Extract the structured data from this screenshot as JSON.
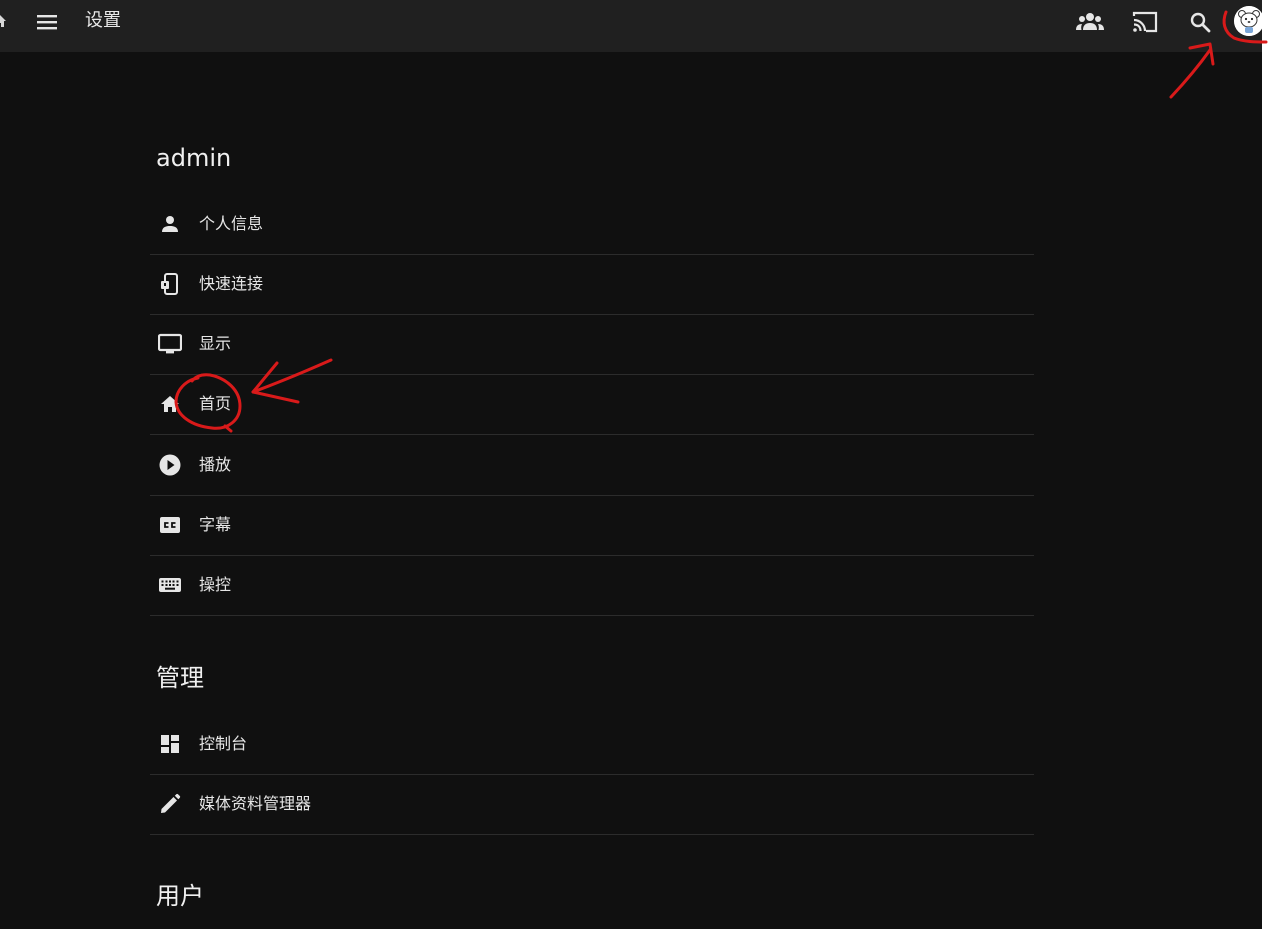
{
  "header": {
    "title": "设置",
    "icons": [
      "home-icon",
      "menu-icon",
      "people-icon",
      "cast-icon",
      "search-icon",
      "avatar"
    ]
  },
  "sections": [
    {
      "title": "admin",
      "items": [
        {
          "label": "个人信息",
          "icon": "person-icon"
        },
        {
          "label": "快速连接",
          "icon": "quick-connect-icon"
        },
        {
          "label": "显示",
          "icon": "monitor-icon"
        },
        {
          "label": "首页",
          "icon": "home-icon"
        },
        {
          "label": "播放",
          "icon": "play-circle-icon"
        },
        {
          "label": "字幕",
          "icon": "closed-caption-icon"
        },
        {
          "label": "操控",
          "icon": "keyboard-icon"
        }
      ]
    },
    {
      "title": "管理",
      "items": [
        {
          "label": "控制台",
          "icon": "dashboard-icon"
        },
        {
          "label": "媒体资料管理器",
          "icon": "pencil-icon"
        }
      ]
    },
    {
      "title": "用户",
      "items": []
    }
  ],
  "colors": {
    "background": "#101010",
    "header": "#202020",
    "text": "#e6e6e6",
    "divider": "#2c2c2c",
    "annotation": "#d91a1a"
  }
}
